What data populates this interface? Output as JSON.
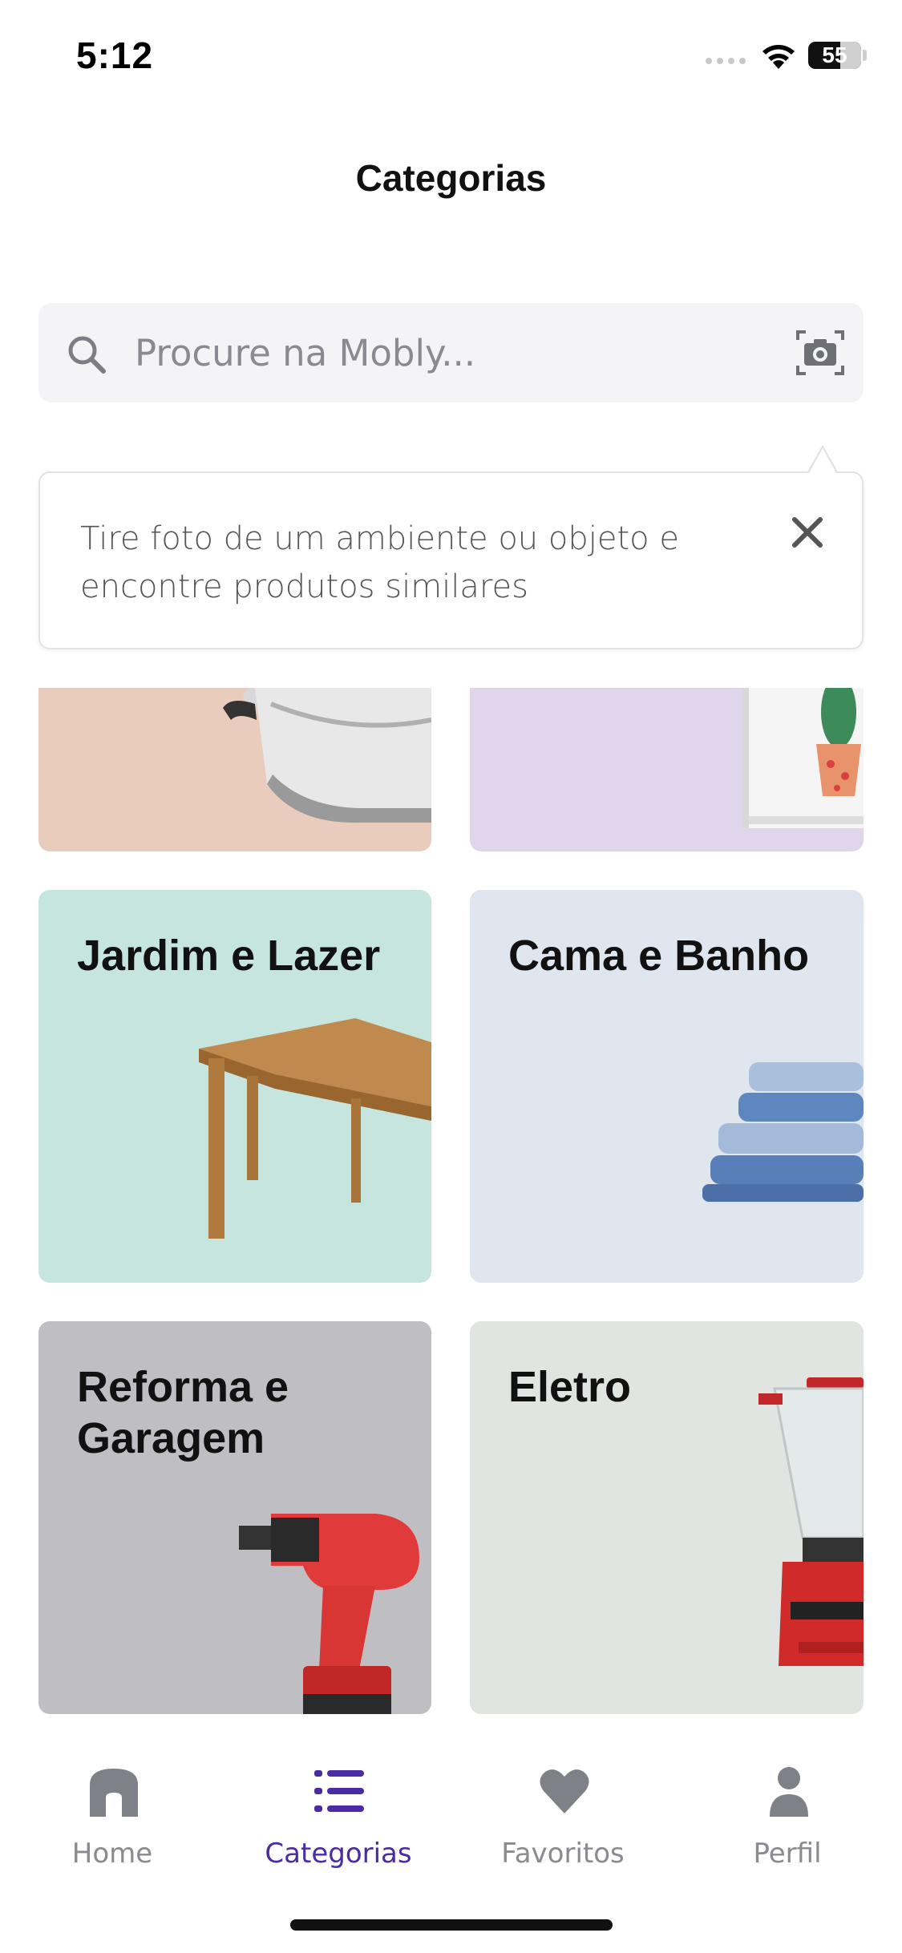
{
  "status_bar": {
    "time": "5:12",
    "battery": "55"
  },
  "header": {
    "title": "Categorias"
  },
  "search": {
    "placeholder": "Procure na Mobly...",
    "value": ""
  },
  "tooltip": {
    "text": "Tire foto de um ambiente ou objeto e encontre produtos similares"
  },
  "categories": [
    {
      "label": "",
      "color": "#e9ccbc",
      "icon": "cookware-pot-image"
    },
    {
      "label": "",
      "color": "#e1d5ec",
      "icon": "cactus-frame-image"
    },
    {
      "label": "Jardim e Lazer",
      "color": "#c6e5de",
      "icon": "wooden-table-image"
    },
    {
      "label": "Cama e Banho",
      "color": "#e0e6ed",
      "icon": "towels-image"
    },
    {
      "label": "Reforma e Garagem",
      "color": "#bfbfc3",
      "icon": "power-drill-image"
    },
    {
      "label": "Eletro",
      "color": "#e1e5e1",
      "icon": "blender-image"
    }
  ],
  "tab_bar": {
    "items": [
      {
        "label": "Home",
        "icon": "home-icon",
        "active": false
      },
      {
        "label": "Categorias",
        "icon": "list-icon",
        "active": true
      },
      {
        "label": "Favoritos",
        "icon": "heart-icon",
        "active": false
      },
      {
        "label": "Perfil",
        "icon": "person-icon",
        "active": false
      }
    ]
  },
  "colors": {
    "accent": "#4b2aa6",
    "inactive_tab": "#8a8a90"
  }
}
